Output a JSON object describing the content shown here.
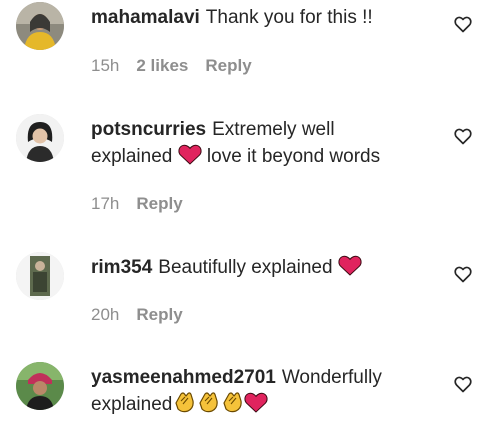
{
  "comments": [
    {
      "username": "mahamalavi",
      "text": "Thank you for this !!",
      "time": "15h",
      "likes": "2 likes",
      "reply": "Reply"
    },
    {
      "username": "potsncurries",
      "text_part1": "Extremely well",
      "text_part2": "explained",
      "text_part3": "love it beyond words",
      "time": "17h",
      "reply": "Reply"
    },
    {
      "username": "rim354",
      "text": "Beautifully explained",
      "time": "20h",
      "reply": "Reply"
    },
    {
      "username": "yasmeenahmed2701",
      "text_part1": "Wonderfully",
      "text_part2": "explained"
    }
  ],
  "icons": {
    "like": "heart-outline-icon",
    "emoji_heart": "red-heart-emoji",
    "emoji_clap": "clapping-hands-emoji"
  },
  "colors": {
    "username": "#262626",
    "meta": "#8e8e8e",
    "heart_red": "#e0245e"
  }
}
